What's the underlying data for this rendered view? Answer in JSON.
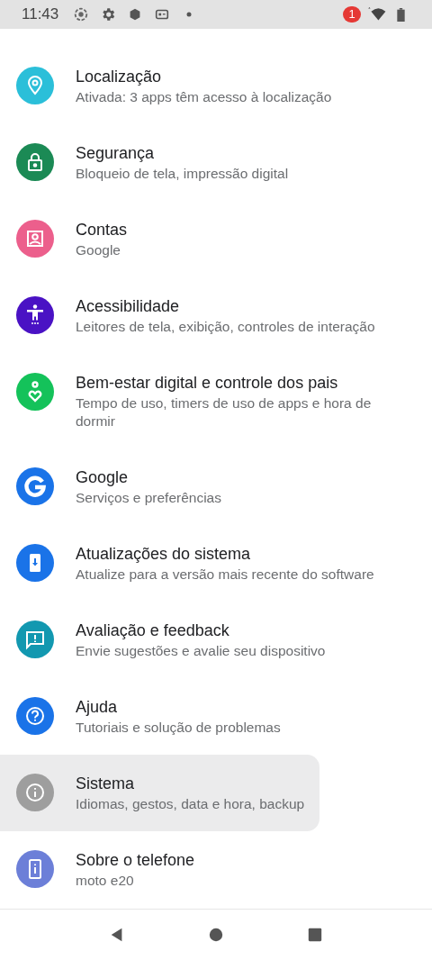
{
  "status_bar": {
    "time": "11:43",
    "notification_count": "1"
  },
  "items": [
    {
      "title": "Localização",
      "subtitle": "Ativada: 3 apps têm acesso à localização",
      "kind": "location",
      "color": "#2bbfd9",
      "selected": false
    },
    {
      "title": "Segurança",
      "subtitle": "Bloqueio de tela, impressão digital",
      "kind": "lock",
      "color": "#1b8a55",
      "selected": false
    },
    {
      "title": "Contas",
      "subtitle": "Google",
      "kind": "account",
      "color": "#ec5f8c",
      "selected": false
    },
    {
      "title": "Acessibilidade",
      "subtitle": "Leitores de tela, exibição, controles de interação",
      "kind": "accessibility",
      "color": "#4a12c4",
      "selected": false
    },
    {
      "title": "Bem-estar digital e controle dos pais",
      "subtitle": "Tempo de uso, timers de uso de apps e hora de dormir",
      "kind": "wellbeing",
      "color": "#14c25a",
      "selected": false
    },
    {
      "title": "Google",
      "subtitle": "Serviços e preferências",
      "kind": "google",
      "color": "#1a73e8",
      "selected": false
    },
    {
      "title": "Atualizações do sistema",
      "subtitle": "Atualize para a versão mais recente do software",
      "kind": "update",
      "color": "#1a73e8",
      "selected": false
    },
    {
      "title": "Avaliação e feedback",
      "subtitle": "Envie sugestões e avalie seu dispositivo",
      "kind": "feedback",
      "color": "#1298b0",
      "selected": false
    },
    {
      "title": "Ajuda",
      "subtitle": "Tutoriais e solução de problemas",
      "kind": "help",
      "color": "#1a73e8",
      "selected": false
    },
    {
      "title": "Sistema",
      "subtitle": "Idiomas, gestos, data e hora, backup",
      "kind": "info",
      "color": "#9e9e9e",
      "selected": true
    },
    {
      "title": "Sobre o telefone",
      "subtitle": "moto e20",
      "kind": "phone",
      "color": "#6c7fd8",
      "selected": false
    }
  ]
}
